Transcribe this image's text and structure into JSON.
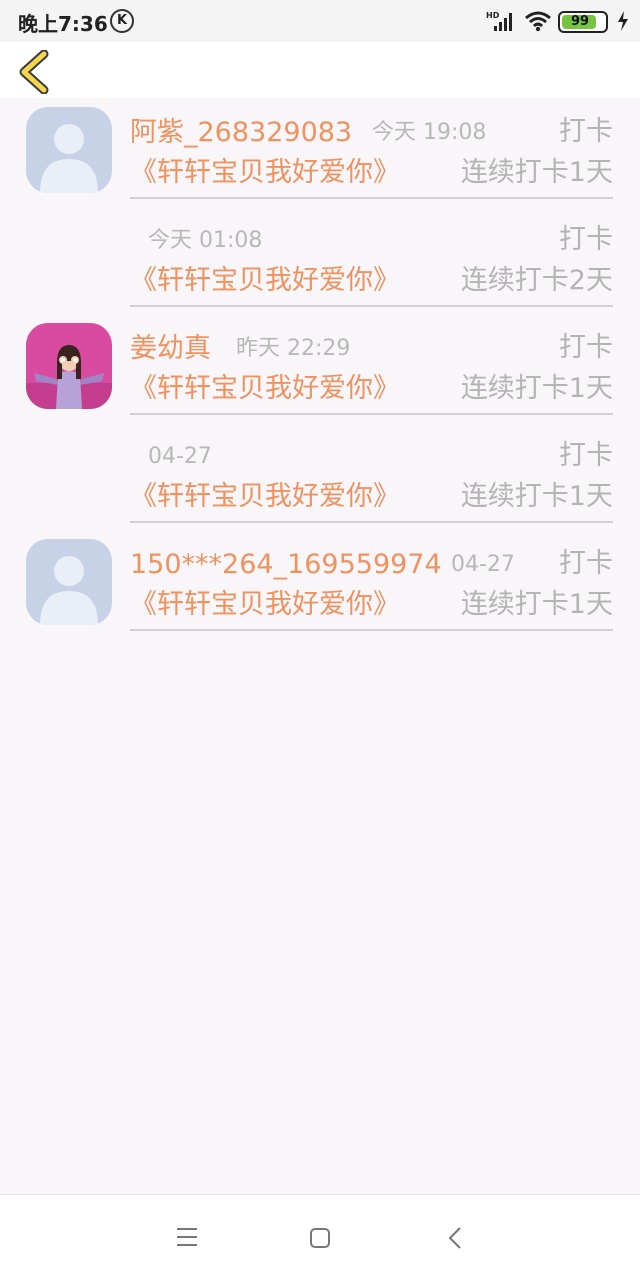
{
  "status_bar": {
    "time": "晚上7:36",
    "k_badge": "K",
    "battery": "99",
    "icons": [
      "k-icon",
      "signal-icon",
      "wifi-icon",
      "battery-icon",
      "charging-bolt-icon"
    ]
  },
  "nav": {
    "back_icon": "chevron-left-icon"
  },
  "colors": {
    "accent": "#ef9260",
    "muted": "#b4b4b4",
    "back_arrow": "#f5d64e",
    "divider": "#d0d0d0"
  },
  "checkins": [
    {
      "name": "阿紫_268329083",
      "time": "今天 19:08",
      "action": "打卡",
      "book": "《轩轩宝贝我好爱你》",
      "streak": "连续打卡1天",
      "avatar": "default-avatar-icon"
    },
    {
      "name": "",
      "time": "今天 01:08",
      "action": "打卡",
      "book": "《轩轩宝贝我好爱你》",
      "streak": "连续打卡2天",
      "avatar": ""
    },
    {
      "name": "姜幼真",
      "time": "昨天 22:29",
      "action": "打卡",
      "book": "《轩轩宝贝我好爱你》",
      "streak": "连续打卡1天",
      "avatar": "photo-avatar"
    },
    {
      "name": "",
      "time": "04-27",
      "action": "打卡",
      "book": "《轩轩宝贝我好爱你》",
      "streak": "连续打卡1天",
      "avatar": ""
    },
    {
      "name": "150***264_169559974",
      "time": "04-27",
      "action": "打卡",
      "book": "《轩轩宝贝我好爱你》",
      "streak": "连续打卡1天",
      "avatar": "default-avatar-icon"
    }
  ],
  "system_nav": {
    "icons": [
      "menu-icon",
      "home-icon",
      "back-icon"
    ]
  }
}
